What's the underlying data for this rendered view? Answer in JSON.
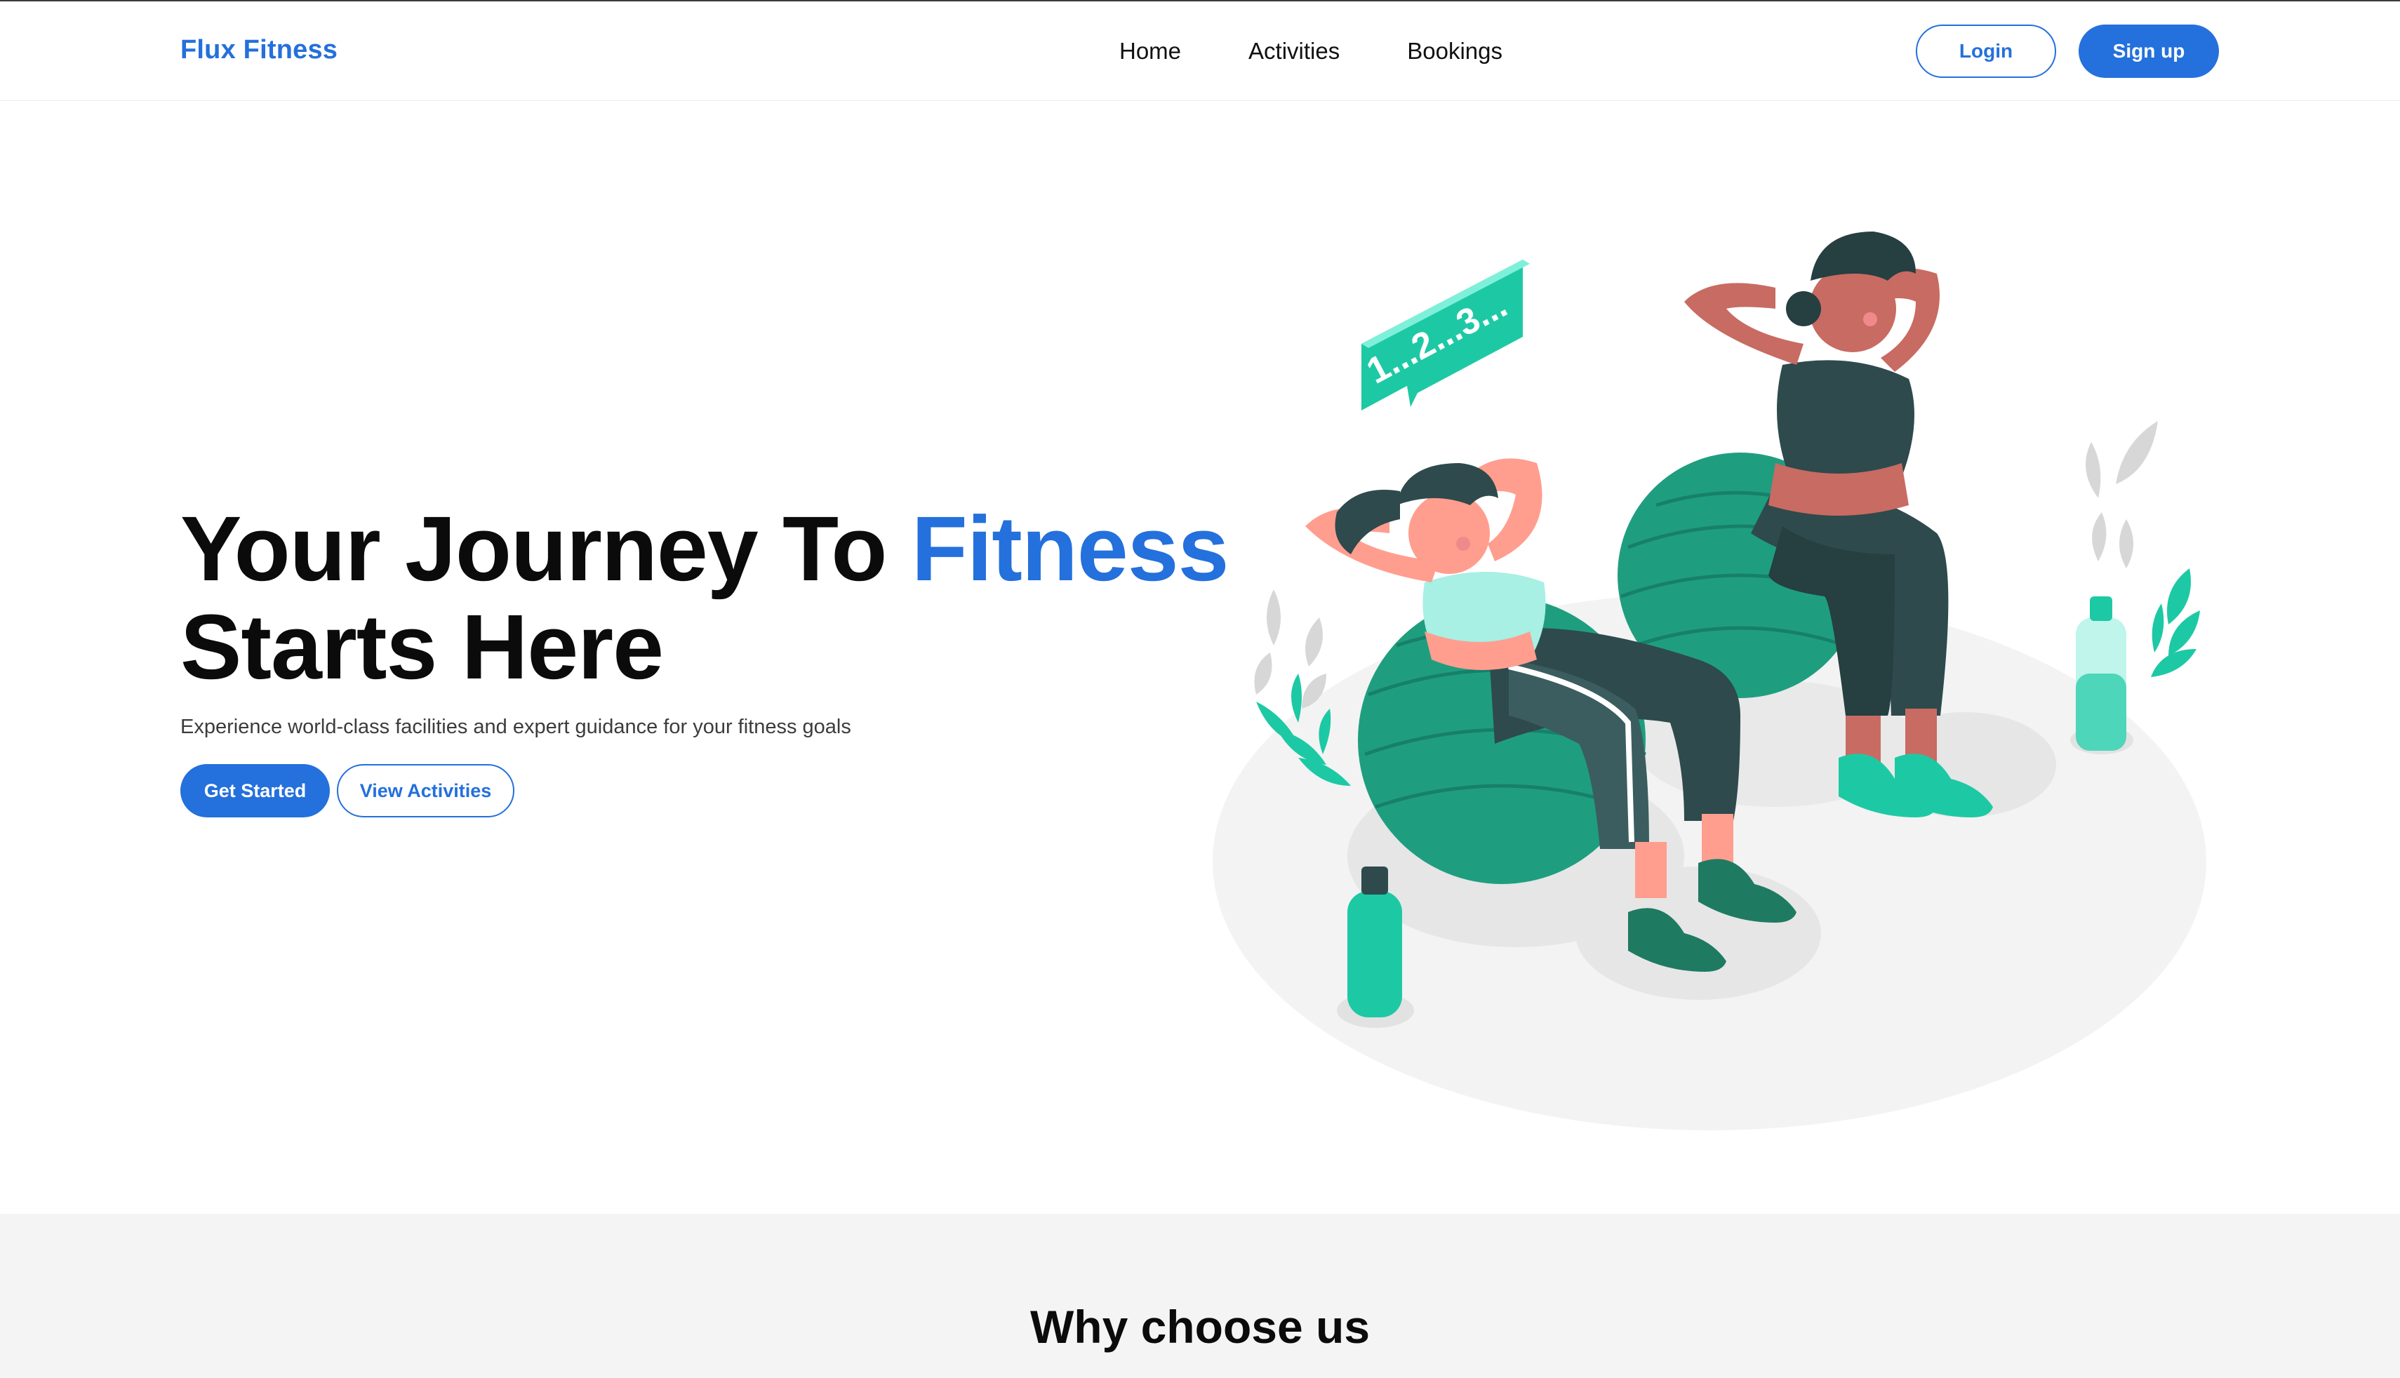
{
  "nav": {
    "brand": "Flux Fitness",
    "links": [
      "Home",
      "Activities",
      "Bookings"
    ],
    "login_label": "Login",
    "signup_label": "Sign up"
  },
  "hero": {
    "title_part1": "Your Journey To ",
    "title_accent": "Fitness",
    "title_part2": "Starts Here",
    "subtitle": "Experience world-class facilities and expert guidance for your fitness goals",
    "primary_cta": "Get Started",
    "secondary_cta": "View Activities",
    "illustration_bubble_text": "1...2...3..."
  },
  "why": {
    "title": "Why choose us"
  },
  "colors": {
    "brand": "#2470dc",
    "teal": "#1dc9a4",
    "ball_green": "#1f9e7f",
    "dark_outfit": "#2e4a4c"
  }
}
